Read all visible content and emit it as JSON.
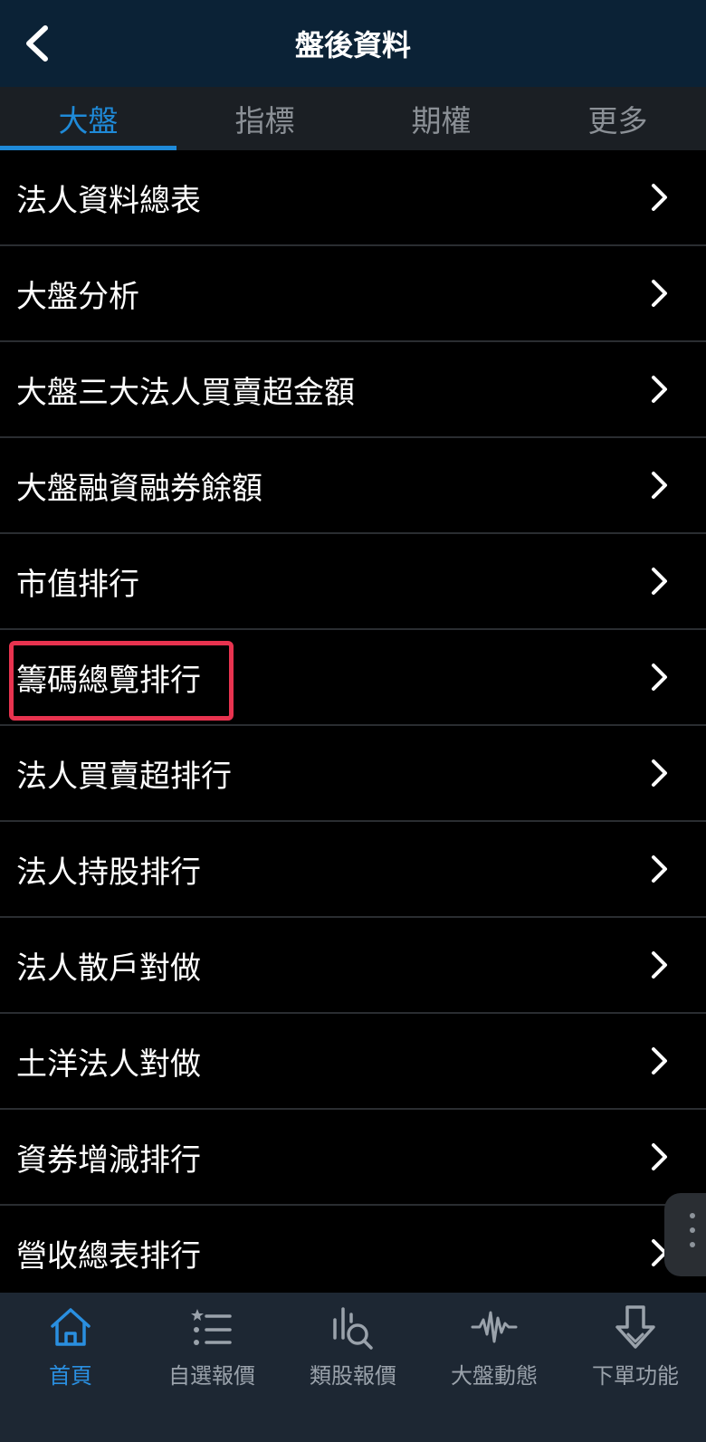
{
  "header": {
    "title": "盤後資料"
  },
  "tabs": [
    {
      "label": "大盤",
      "active": true
    },
    {
      "label": "指標",
      "active": false
    },
    {
      "label": "期權",
      "active": false
    },
    {
      "label": "更多",
      "active": false
    }
  ],
  "list": {
    "items": [
      {
        "label": "法人資料總表"
      },
      {
        "label": "大盤分析"
      },
      {
        "label": "大盤三大法人買賣超金額"
      },
      {
        "label": "大盤融資融券餘額"
      },
      {
        "label": "市值排行"
      },
      {
        "label": "籌碼總覽排行",
        "highlighted": true
      },
      {
        "label": "法人買賣超排行"
      },
      {
        "label": "法人持股排行"
      },
      {
        "label": "法人散戶對做"
      },
      {
        "label": "土洋法人對做"
      },
      {
        "label": "資券增減排行"
      },
      {
        "label": "營收總表排行"
      }
    ]
  },
  "tabbar": {
    "items": [
      {
        "label": "首頁",
        "icon": "home-icon",
        "active": true
      },
      {
        "label": "自選報價",
        "icon": "star-list-icon",
        "active": false
      },
      {
        "label": "類股報價",
        "icon": "sector-search-icon",
        "active": false
      },
      {
        "label": "大盤動態",
        "icon": "waveform-icon",
        "active": false
      },
      {
        "label": "下單功能",
        "icon": "order-arrow-icon",
        "active": false
      }
    ]
  },
  "colors": {
    "accent": "#1f8ad8",
    "highlight_border": "#e8334f",
    "header_bg": "#0b2236",
    "tabbar_bg": "#1d2733"
  }
}
